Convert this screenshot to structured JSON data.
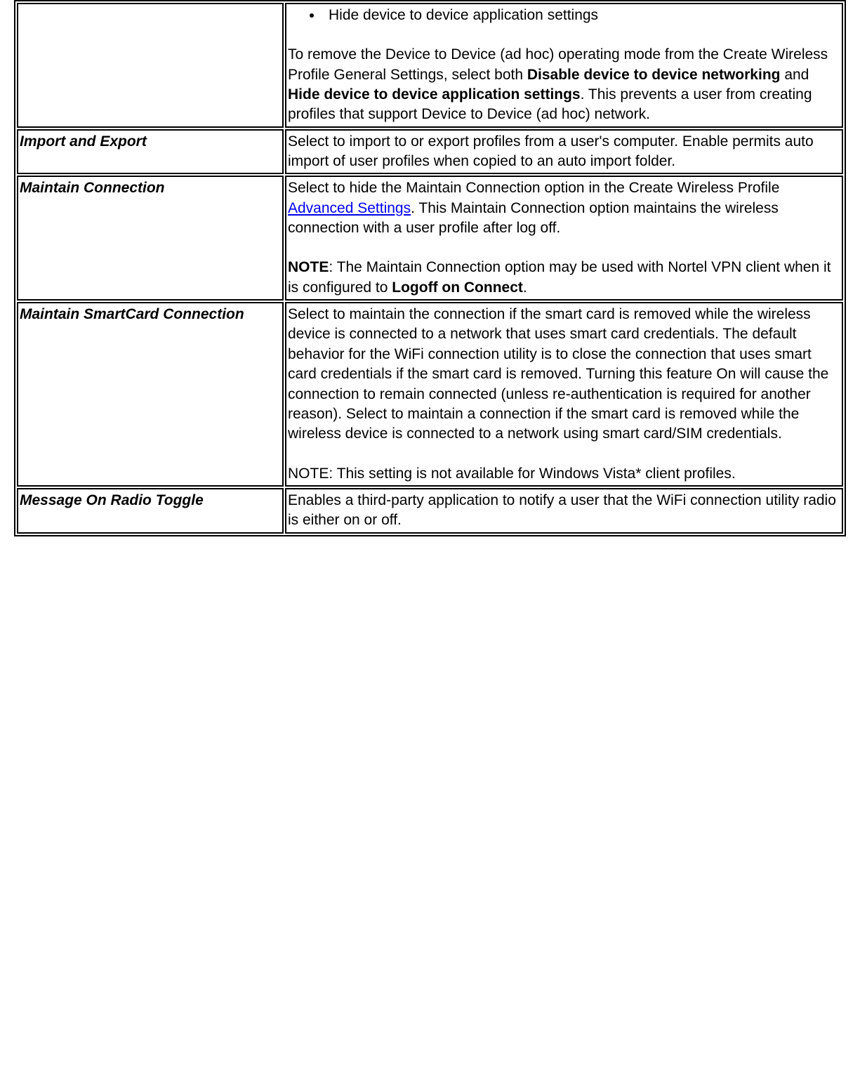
{
  "row0": {
    "bullet1": "Hide device to device application settings",
    "p1_a": "To remove the Device to Device (ad hoc) operating mode from the Create Wireless Profile General Settings, select both ",
    "p1_b": "Disable device to device networking",
    "p1_c": " and ",
    "p1_d": "Hide device to device application settings",
    "p1_e": ". This prevents a user from creating profiles that support Device to Device (ad hoc) network."
  },
  "row1": {
    "name": "Import and Export",
    "desc": "Select to import to or export profiles from a user's computer. Enable permits auto import of user profiles when copied to an auto import folder."
  },
  "row2": {
    "name": "Maintain Connection",
    "p1_a": "Select to hide the Maintain Connection option in the Create Wireless Profile ",
    "link": "Advanced Settings",
    "p1_b": ". This Maintain Connection option maintains the wireless connection with a user profile after log off.",
    "p2_a": "NOTE",
    "p2_b": ": The Maintain Connection option may be used with Nortel VPN client when it is configured to ",
    "p2_c": "Logoff on Connect",
    "p2_d": "."
  },
  "row3": {
    "name": "Maintain SmartCard Connection",
    "p1": "Select to maintain the connection if the smart card is removed while the wireless device is connected to a network that uses smart card credentials. The default behavior for the WiFi connection utility is to close the connection that uses smart card credentials if the smart card is removed. Turning this feature On will cause the connection to remain connected (unless re-authentication is required for another reason). Select to maintain a connection if the smart card is removed while the wireless device is connected to a network using smart card/SIM credentials.",
    "p2": "NOTE: This setting is not available for Windows Vista* client profiles."
  },
  "row4": {
    "name": "Message On Radio Toggle",
    "desc": "Enables a third-party application to notify a user that the WiFi connection utility radio is either on or off."
  }
}
